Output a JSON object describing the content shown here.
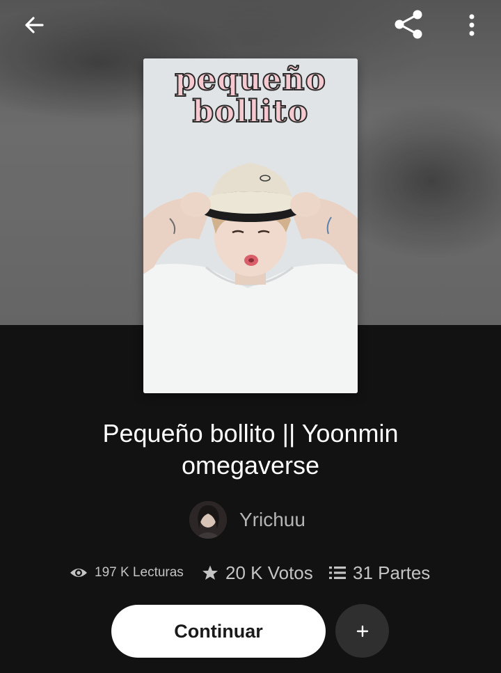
{
  "story": {
    "cover_title_line1": "pequeño",
    "cover_title_line2": "bollito",
    "title": "Pequeño bollito || Yoonmin omegaverse"
  },
  "author": {
    "name": "Yrichuu"
  },
  "stats": {
    "reads": "197 K Lecturas",
    "votes": "20 K Votos",
    "parts": "31 Partes"
  },
  "actions": {
    "continue_label": "Continuar",
    "add_label": "+"
  },
  "icons": {
    "back": "arrow-left-icon",
    "share": "share-icon",
    "more": "more-vertical-icon",
    "reads": "eye-icon",
    "votes": "star-icon",
    "parts": "list-icon"
  },
  "colors": {
    "background": "#121212",
    "continue_button": "#ffffff",
    "add_button": "#2f2f2f",
    "stat_text": "#c4c4c4",
    "author_text": "#b5b5b5"
  }
}
